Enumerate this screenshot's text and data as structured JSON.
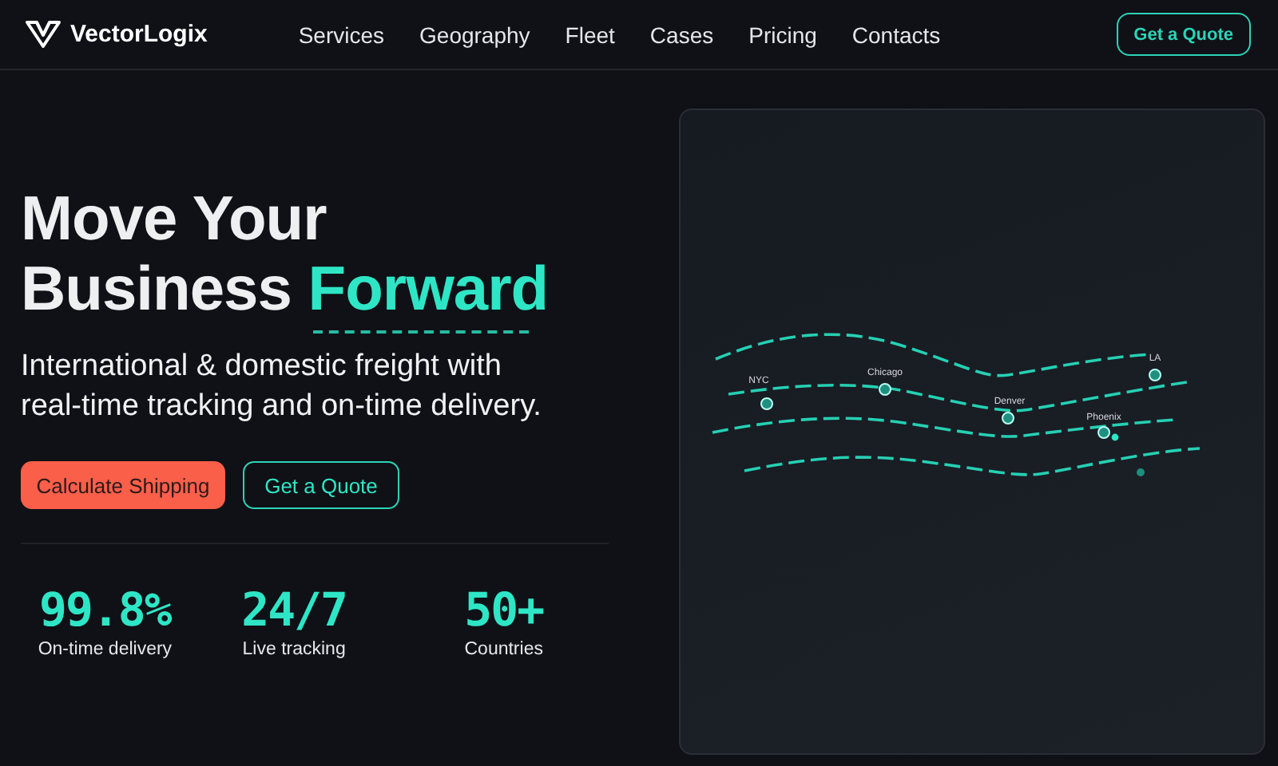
{
  "brand": {
    "name": "VectorLogix"
  },
  "nav": {
    "links": [
      "Services",
      "Geography",
      "Fleet",
      "Cases",
      "Pricing",
      "Contacts"
    ],
    "cta": "Get a Quote"
  },
  "hero": {
    "title_line1": "Move Your",
    "title_line2": "Business",
    "title_highlight": "Forward",
    "subtitle": "International & domestic freight with real-time tracking and on-time delivery.",
    "buttons": [
      {
        "label": "Calculate Shipping",
        "kind": "primary"
      },
      {
        "label": "Get a Quote",
        "kind": "outline"
      }
    ]
  },
  "stats": [
    {
      "value": "99.8%",
      "label": "On-time delivery"
    },
    {
      "value": "24/7",
      "label": "Live tracking"
    },
    {
      "value": "50+",
      "label": "Countries"
    }
  ],
  "map": {
    "cities": [
      "NYC",
      "Chicago",
      "Denver",
      "Phoenix",
      "LA"
    ]
  }
}
